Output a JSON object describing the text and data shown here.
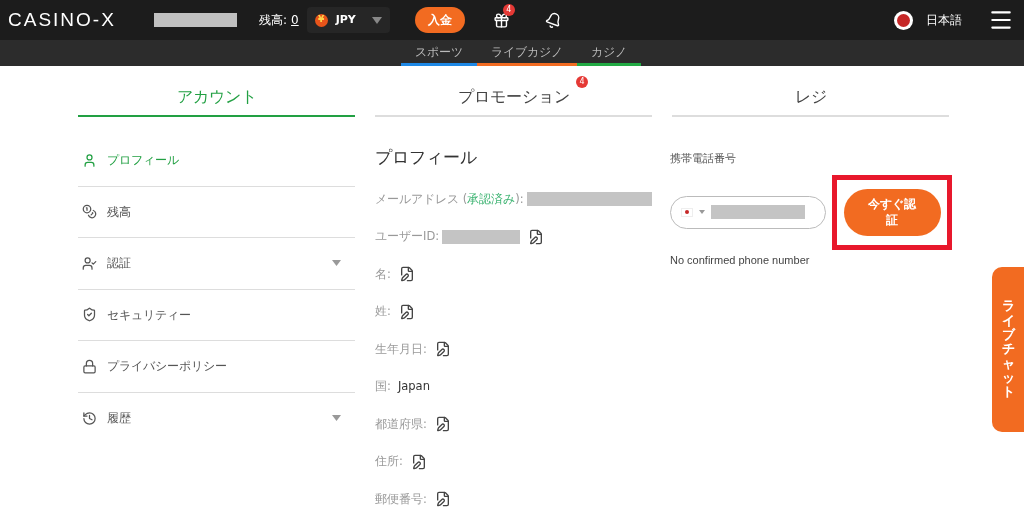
{
  "header": {
    "logo": "CASINO-X",
    "balance_label": "残高:",
    "balance": "0",
    "currency_symbol": "¥",
    "currency": "JPY",
    "deposit": "入金",
    "gift_badge": "4",
    "language": "日本語"
  },
  "subnav": [
    {
      "label": "スポーツ",
      "color": "#1e88e5"
    },
    {
      "label": "ライブカジノ",
      "color": "#f26b21"
    },
    {
      "label": "カジノ",
      "color": "#22aa44"
    }
  ],
  "tabs": [
    {
      "label": "アカウント",
      "selected": true
    },
    {
      "label": "プロモーション",
      "selected": false,
      "badge": "4"
    },
    {
      "label": "レジ",
      "selected": false
    }
  ],
  "sidebar": {
    "items": [
      {
        "label": "プロフィール",
        "selected": true,
        "expandable": false
      },
      {
        "label": "残高",
        "selected": false,
        "expandable": false
      },
      {
        "label": "認証",
        "selected": false,
        "expandable": true
      },
      {
        "label": "セキュリティー",
        "selected": false,
        "expandable": false
      },
      {
        "label": "プライバシーポリシー",
        "selected": false,
        "expandable": false
      },
      {
        "label": "履歴",
        "selected": false,
        "expandable": true
      }
    ]
  },
  "profile": {
    "title": "プロフィール",
    "fields": [
      {
        "kind": "redacted",
        "label": "メールアドレス (",
        "status": "承認済み",
        "suffix": "):",
        "editable": false
      },
      {
        "kind": "redacted",
        "label": "ユーザーID:",
        "editable": true
      },
      {
        "kind": "empty",
        "label": "名:",
        "editable": true
      },
      {
        "kind": "empty",
        "label": "姓:",
        "editable": true
      },
      {
        "kind": "empty",
        "label": "生年月日:",
        "editable": true
      },
      {
        "kind": "text",
        "label": "国:",
        "value": "Japan",
        "editable": false
      },
      {
        "kind": "empty",
        "label": "都道府県:",
        "editable": true
      },
      {
        "kind": "empty",
        "label": "住所:",
        "editable": true
      },
      {
        "kind": "empty",
        "label": "郵便番号:",
        "editable": true
      }
    ]
  },
  "phone": {
    "label": "携帯電話番号",
    "verify_button": "今すぐ認証",
    "highlighted": true,
    "status": "No confirmed phone number"
  },
  "live_chat": "ライブチャット"
}
